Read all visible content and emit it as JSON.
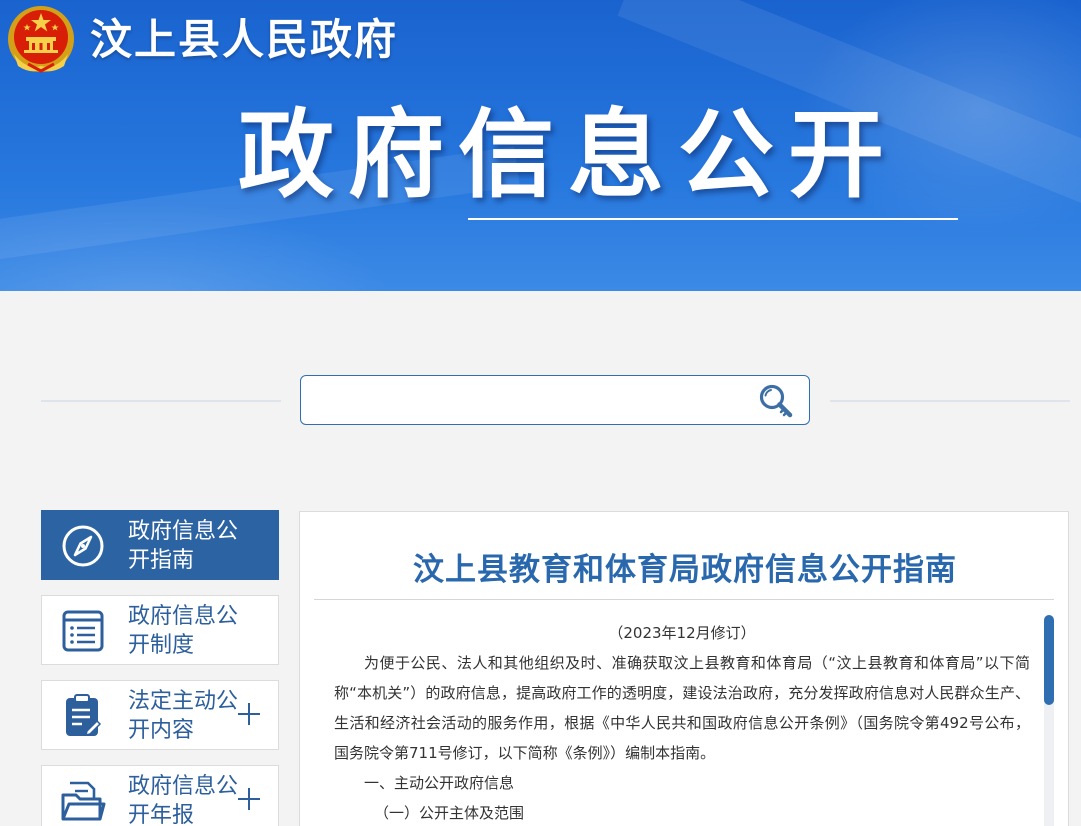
{
  "header": {
    "site_name": "汶上县人民政府",
    "banner_title": "政府信息公开",
    "emblem_icon": "national-emblem-icon",
    "brand_color": "#2677de"
  },
  "search": {
    "value": "",
    "placeholder": "",
    "icon": "search-icon",
    "border_color": "#2f6fb1"
  },
  "sidebar": {
    "items": [
      {
        "label": "政府信息公开指南",
        "icon": "compass-icon",
        "active": true,
        "expandable": false
      },
      {
        "label": "政府信息公开制度",
        "icon": "list-document-icon",
        "active": false,
        "expandable": false
      },
      {
        "label": "法定主动公开内容",
        "icon": "clipboard-edit-icon",
        "active": false,
        "expandable": true
      },
      {
        "label": "政府信息公开年报",
        "icon": "open-folder-icon",
        "active": false,
        "expandable": true
      }
    ],
    "active_color": "#2c63a2"
  },
  "article": {
    "title": "汶上县教育和体育局政府信息公开指南",
    "revision": "（2023年12月修订）",
    "intro": "为便于公民、法人和其他组织及时、准确获取汶上县教育和体育局（“汶上县教育和体育局”以下简称“本机关”）的政府信息，提高政府工作的透明度，建设法治政府，充分发挥政府信息对人民群众生产、生活和经济社会活动的服务作用，根据《中华人民共和国政府信息公开条例》（国务院令第492号公布，国务院令第711号修订，以下简称《条例》）编制本指南。",
    "section1": "一、主动公开政府信息",
    "section1_1": "（一）公开主体及范围",
    "title_color": "#2a68ae"
  }
}
